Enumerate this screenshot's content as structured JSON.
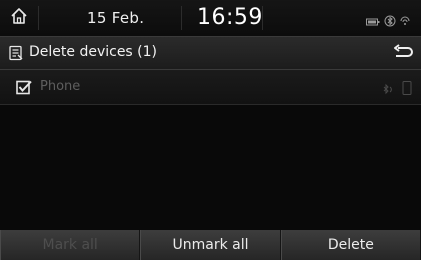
{
  "status": {
    "date": "15 Feb.",
    "time": "16:59",
    "icons": [
      "home-icon",
      "battery-icon",
      "bluetooth-icon",
      "signal-icon"
    ]
  },
  "title": {
    "text": "Delete devices (1)",
    "icon": "document-list-icon",
    "back_icon": "back-arrow-icon"
  },
  "devices": [
    {
      "label": "Phone",
      "checked": true,
      "icons": [
        "bluetooth-audio-icon",
        "phone-icon"
      ]
    }
  ],
  "buttons": {
    "mark_all": "Mark all",
    "unmark_all": "Unmark all",
    "delete": "Delete"
  },
  "colors": {
    "background": "#090909",
    "text": "#ececec",
    "disabled_text": "#4e4e4e"
  }
}
